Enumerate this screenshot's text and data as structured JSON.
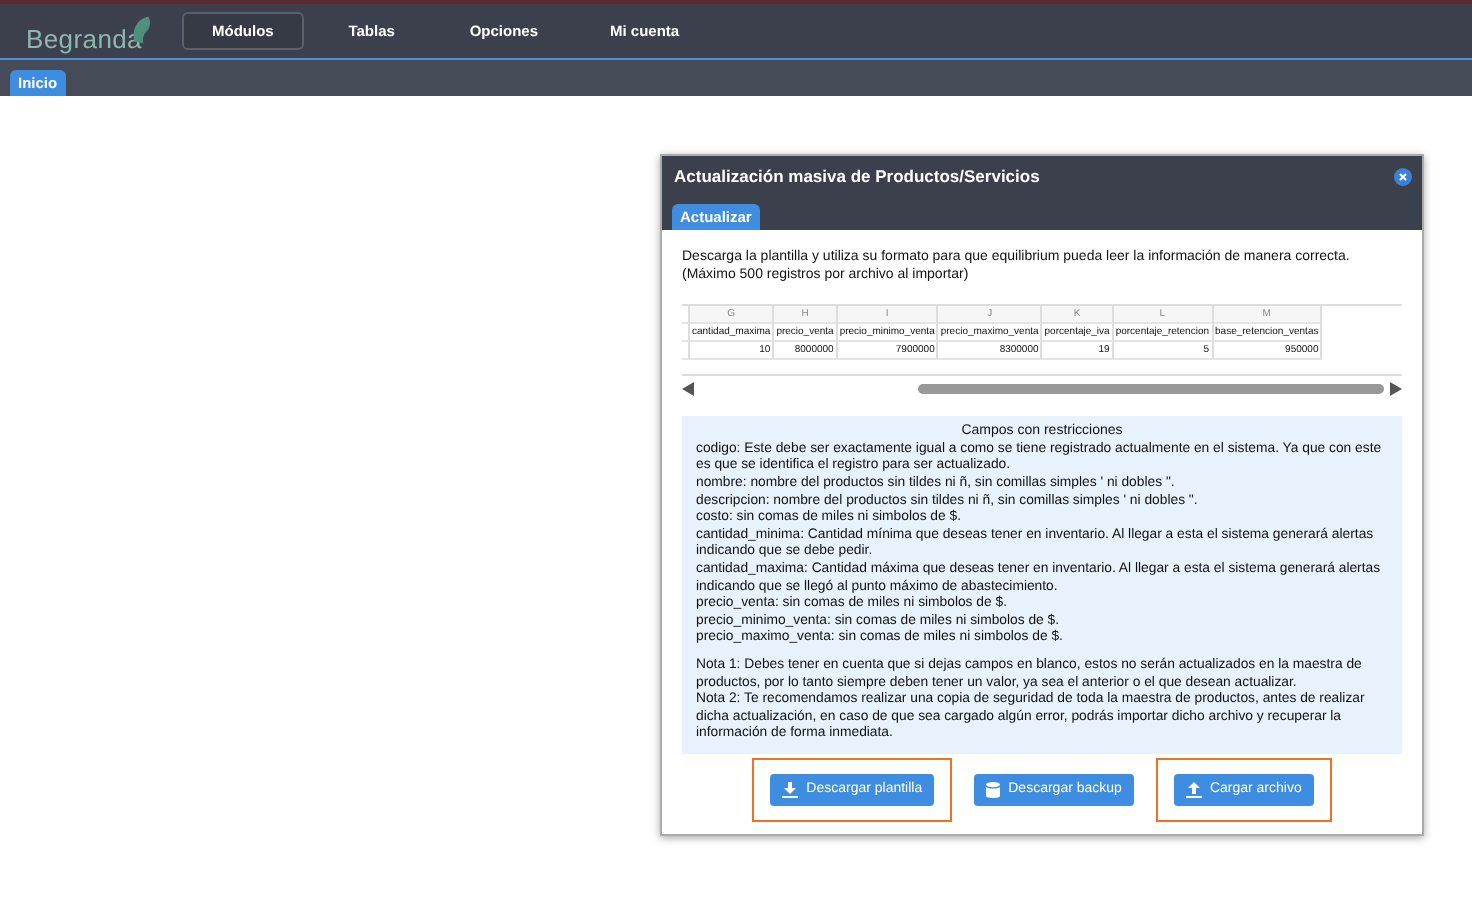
{
  "nav": {
    "logo": "Begranda",
    "items": [
      {
        "label": "Módulos",
        "selected": true
      },
      {
        "label": "Tablas",
        "selected": false
      },
      {
        "label": "Opciones",
        "selected": false
      },
      {
        "label": "Mi cuenta",
        "selected": false
      }
    ]
  },
  "tabs": [
    {
      "label": "Inicio",
      "selected": true
    }
  ],
  "dialog": {
    "title": "Actualización masiva de Productos/Servicios",
    "tabs": [
      {
        "label": "Actualizar",
        "selected": true
      }
    ],
    "intro": [
      "Descarga la plantilla y utiliza su formato para que equilibrium pueda leer la información de manera correcta.",
      "(Máximo 500 registros por archivo al importar)"
    ],
    "sheet": {
      "columns": [
        {
          "letter": "G",
          "header": "cantidad_maxima",
          "value": "10"
        },
        {
          "letter": "H",
          "header": "precio_venta",
          "value": "8000000"
        },
        {
          "letter": "I",
          "header": "precio_minimo_venta",
          "value": "7900000"
        },
        {
          "letter": "J",
          "header": "precio_maximo_venta",
          "value": "8300000"
        },
        {
          "letter": "K",
          "header": "porcentaje_iva",
          "value": "19"
        },
        {
          "letter": "L",
          "header": "porcentaje_retencion",
          "value": "5"
        },
        {
          "letter": "M",
          "header": "base_retencion_ventas",
          "value": "950000"
        }
      ]
    },
    "restrictions": {
      "title": "Campos con restricciones",
      "lines": [
        "codigo: Este debe ser exactamente igual a como se tiene registrado actualmente en el sistema. Ya que con este es que se identifica el registro para ser actualizado.",
        "nombre: nombre del productos sin tildes ni ñ, sin comillas simples ' ni dobles \".",
        "descripcion: nombre del productos sin tildes ni ñ, sin comillas simples ' ni dobles \".",
        "costo: sin comas de miles ni simbolos de $.",
        "cantidad_minima: Cantidad mínima que deseas tener en inventario. Al llegar a esta el sistema generará alertas indicando que se debe pedir.",
        "cantidad_maxima: Cantidad máxima que deseas tener en inventario. Al llegar a esta el sistema generará alertas indicando que se llegó al punto máximo de abastecimiento.",
        "precio_venta: sin comas de miles ni simbolos de $.",
        "precio_minimo_venta: sin comas de miles ni simbolos de $.",
        "precio_maximo_venta: sin comas de miles ni simbolos de $."
      ],
      "notes": [
        "Nota 1: Debes tener en cuenta que si dejas campos en blanco, estos no serán actualizados en la maestra de productos, por lo tanto siempre deben tener un valor, ya sea el anterior o el que desean actualizar.",
        "Nota 2: Te recomendamos realizar una copia de seguridad de toda la maestra de productos, antes de realizar dicha actualización, en caso de que sea cargado algún error, podrás importar dicho archivo y recuperar la información de forma inmediata."
      ]
    },
    "buttons": [
      {
        "label": "Descargar plantilla",
        "kind": "download",
        "highlighted": true
      },
      {
        "label": "Descargar backup",
        "kind": "database",
        "highlighted": false
      },
      {
        "label": "Cargar archivo",
        "kind": "upload",
        "highlighted": true
      }
    ]
  }
}
